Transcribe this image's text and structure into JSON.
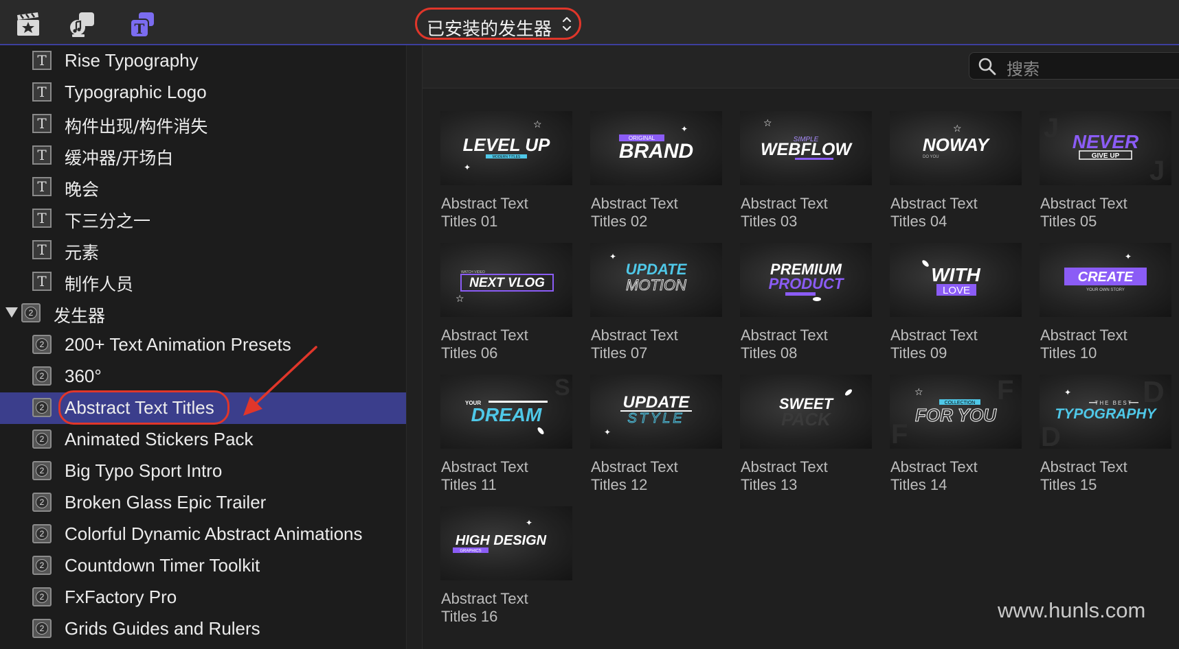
{
  "toolbar": {
    "icons": [
      "clapper-star-icon",
      "music-camera-icon",
      "titles-generators-icon"
    ],
    "popup_label": "已安装的发生器"
  },
  "sidebar": {
    "title_items": [
      "Rise Typography",
      "Typographic Logo",
      "构件出现/构件消失",
      "缓冲器/开场白",
      "晚会",
      "下三分之一",
      "元素",
      "制作人员"
    ],
    "generators_header": "发生器",
    "generator_items": [
      "200+ Text Animation Presets",
      "360°",
      "Abstract Text Titles",
      "Animated Stickers Pack",
      "Big Typo Sport Intro",
      "Broken Glass Epic Trailer",
      "Colorful Dynamic Abstract Animations",
      "Countdown Timer Toolkit",
      "FxFactory Pro",
      "Grids Guides and Rulers"
    ],
    "selected_item": "Abstract Text Titles"
  },
  "search": {
    "placeholder": "搜索"
  },
  "browser": {
    "tiles": [
      {
        "caption_line1": "Abstract Text",
        "caption_line2": "Titles 01",
        "thumb_text": "LEVEL UP",
        "thumb_sub": "MODERN TITLES"
      },
      {
        "caption_line1": "Abstract Text",
        "caption_line2": "Titles 02",
        "thumb_text": "BRAND",
        "thumb_sub": "ORIGINAL"
      },
      {
        "caption_line1": "Abstract Text",
        "caption_line2": "Titles 03",
        "thumb_text": "WEBFLOW",
        "thumb_sub": "SIMPLE"
      },
      {
        "caption_line1": "Abstract Text",
        "caption_line2": "Titles 04",
        "thumb_text": "NOWAY",
        "thumb_sub": "DO YOU"
      },
      {
        "caption_line1": "Abstract Text",
        "caption_line2": "Titles 05",
        "thumb_text": "NEVER",
        "thumb_sub": "GIVE UP"
      },
      {
        "caption_line1": "Abstract Text",
        "caption_line2": "Titles 06",
        "thumb_text": "NEXT VLOG",
        "thumb_sub": "WATCH VIDEO"
      },
      {
        "caption_line1": "Abstract Text",
        "caption_line2": "Titles 07",
        "thumb_text": "UPDATE",
        "thumb_sub": "MOTION"
      },
      {
        "caption_line1": "Abstract Text",
        "caption_line2": "Titles 08",
        "thumb_text": "PREMIUM",
        "thumb_sub": "PRODUCT"
      },
      {
        "caption_line1": "Abstract Text",
        "caption_line2": "Titles 09",
        "thumb_text": "WITH",
        "thumb_sub": "LOVE"
      },
      {
        "caption_line1": "Abstract Text",
        "caption_line2": "Titles 10",
        "thumb_text": "CREATE",
        "thumb_sub": "YOUR OWN STORY"
      },
      {
        "caption_line1": "Abstract Text",
        "caption_line2": "Titles 11",
        "thumb_text": "DREAM",
        "thumb_sub": "YOUR"
      },
      {
        "caption_line1": "Abstract Text",
        "caption_line2": "Titles 12",
        "thumb_text": "UPDATE",
        "thumb_sub": "STYLE"
      },
      {
        "caption_line1": "Abstract Text",
        "caption_line2": "Titles 13",
        "thumb_text": "SWEET",
        "thumb_sub": "PACK"
      },
      {
        "caption_line1": "Abstract Text",
        "caption_line2": "Titles 14",
        "thumb_text": "FOR YOU",
        "thumb_sub": "COLLECTION"
      },
      {
        "caption_line1": "Abstract Text",
        "caption_line2": "Titles 15",
        "thumb_text": "TYPOGRAPHY",
        "thumb_sub": "THE BEST"
      },
      {
        "caption_line1": "Abstract Text",
        "caption_line2": "Titles 16",
        "thumb_text": "HIGH DESIGN",
        "thumb_sub": "GRAPHICS"
      }
    ]
  },
  "watermark": "www.hunls.com",
  "colors": {
    "selection": "#3b3e8c",
    "annotation_red": "#e0362a",
    "accent_purple": "#8b5cf6",
    "accent_cyan": "#4fc8e8"
  }
}
